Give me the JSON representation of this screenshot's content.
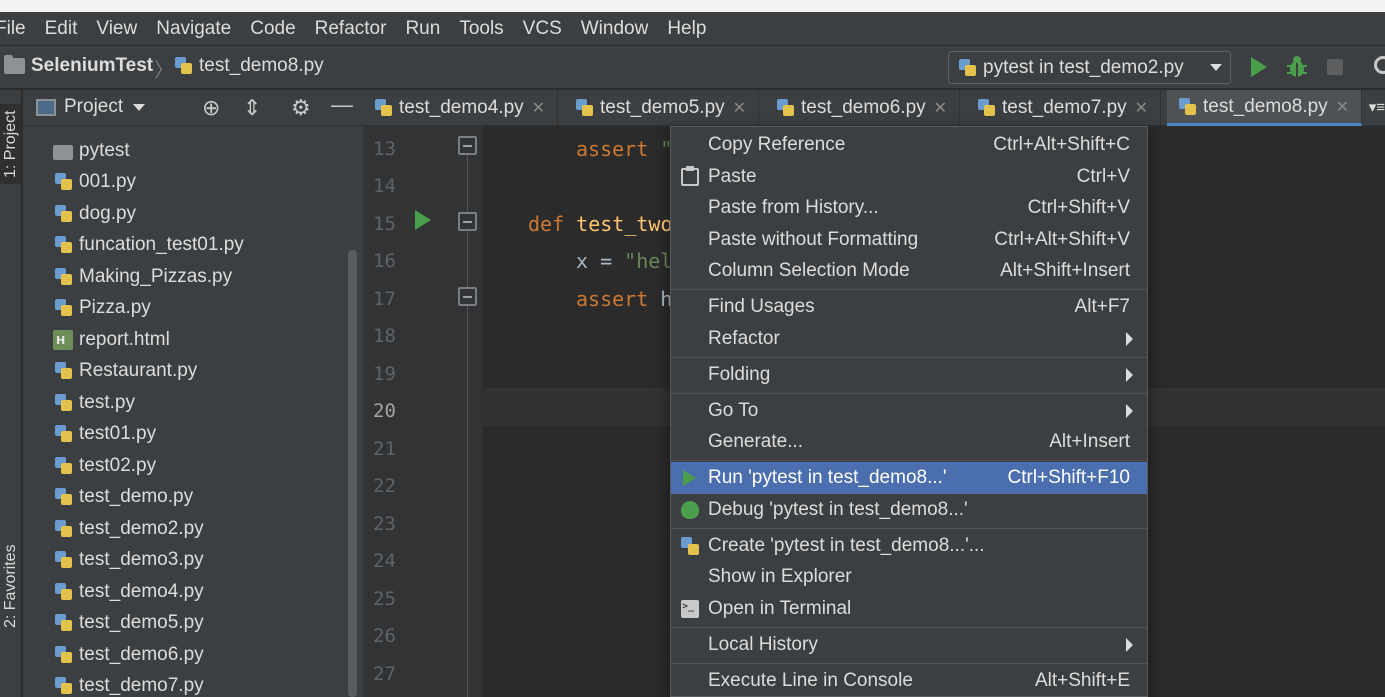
{
  "menubar": [
    "File",
    "Edit",
    "View",
    "Navigate",
    "Code",
    "Refactor",
    "Run",
    "Tools",
    "VCS",
    "Window",
    "Help"
  ],
  "navbar": {
    "project": "SeleniumTest",
    "separator": "〉",
    "file": "test_demo8.py",
    "run_config": "pytest in test_demo2.py"
  },
  "left_strip": {
    "project_tab": "1: Project",
    "favorites_tab": "2: Favorites"
  },
  "project_panel": {
    "title": "Project",
    "items": [
      {
        "name": "pytest",
        "type": "folder"
      },
      {
        "name": "001.py",
        "type": "py"
      },
      {
        "name": "dog.py",
        "type": "py"
      },
      {
        "name": "funcation_test01.py",
        "type": "py"
      },
      {
        "name": "Making_Pizzas.py",
        "type": "py"
      },
      {
        "name": "Pizza.py",
        "type": "py"
      },
      {
        "name": "report.html",
        "type": "html"
      },
      {
        "name": "Restaurant.py",
        "type": "py"
      },
      {
        "name": "test.py",
        "type": "py"
      },
      {
        "name": "test01.py",
        "type": "py"
      },
      {
        "name": "test02.py",
        "type": "py"
      },
      {
        "name": "test_demo.py",
        "type": "py"
      },
      {
        "name": "test_demo2.py",
        "type": "py"
      },
      {
        "name": "test_demo3.py",
        "type": "py"
      },
      {
        "name": "test_demo4.py",
        "type": "py"
      },
      {
        "name": "test_demo5.py",
        "type": "py"
      },
      {
        "name": "test_demo6.py",
        "type": "py"
      },
      {
        "name": "test_demo7.py",
        "type": "py"
      }
    ]
  },
  "editor_tabs": [
    {
      "label": "test_demo4.py",
      "active": false
    },
    {
      "label": "test_demo5.py",
      "active": false
    },
    {
      "label": "test_demo6.py",
      "active": false
    },
    {
      "label": "test_demo7.py",
      "active": false
    },
    {
      "label": "test_demo8.py",
      "active": true
    }
  ],
  "editor": {
    "line_numbers": [
      "13",
      "14",
      "15",
      "16",
      "17",
      "18",
      "19",
      "20",
      "21",
      "22",
      "23",
      "24",
      "25",
      "26",
      "27"
    ],
    "code": {
      "line13_kw": "assert",
      "line13_rest": " \"",
      "line15_kw": "def",
      "line15_fn": " test_two",
      "line16_var": "x = ",
      "line16_str": "\"hel",
      "line17_kw": "assert",
      "line17_rest": " h"
    }
  },
  "context_menu": {
    "items": [
      {
        "label": "Copy Reference",
        "shortcut": "Ctrl+Alt+Shift+C"
      },
      {
        "label": "Paste",
        "shortcut": "Ctrl+V"
      },
      {
        "label": "Paste from History...",
        "shortcut": "Ctrl+Shift+V"
      },
      {
        "label": "Paste without Formatting",
        "shortcut": "Ctrl+Alt+Shift+V"
      },
      {
        "label": "Column Selection Mode",
        "shortcut": "Alt+Shift+Insert"
      },
      {
        "label": "Find Usages",
        "shortcut": "Alt+F7"
      },
      {
        "label": "Refactor",
        "shortcut": ""
      },
      {
        "label": "Folding",
        "shortcut": ""
      },
      {
        "label": "Go To",
        "shortcut": ""
      },
      {
        "label": "Generate...",
        "shortcut": "Alt+Insert"
      },
      {
        "label": "Run 'pytest in test_demo8...'",
        "shortcut": "Ctrl+Shift+F10"
      },
      {
        "label": "Debug 'pytest in test_demo8...'",
        "shortcut": ""
      },
      {
        "label": "Create 'pytest in test_demo8...'...",
        "shortcut": ""
      },
      {
        "label": "Show in Explorer",
        "shortcut": ""
      },
      {
        "label": "Open in Terminal",
        "shortcut": ""
      },
      {
        "label": "Local History",
        "shortcut": ""
      },
      {
        "label": "Execute Line in Console",
        "shortcut": "Alt+Shift+E"
      }
    ],
    "highlighted": "Run 'pytest in test_demo8...'"
  },
  "colors": {
    "background": "#2b2b2b",
    "panel": "#3c3f41",
    "highlight": "#4b6eaf",
    "run_green": "#4a9e4c",
    "keyword": "#cc7832",
    "function": "#ffc66d",
    "string": "#6a8759"
  }
}
